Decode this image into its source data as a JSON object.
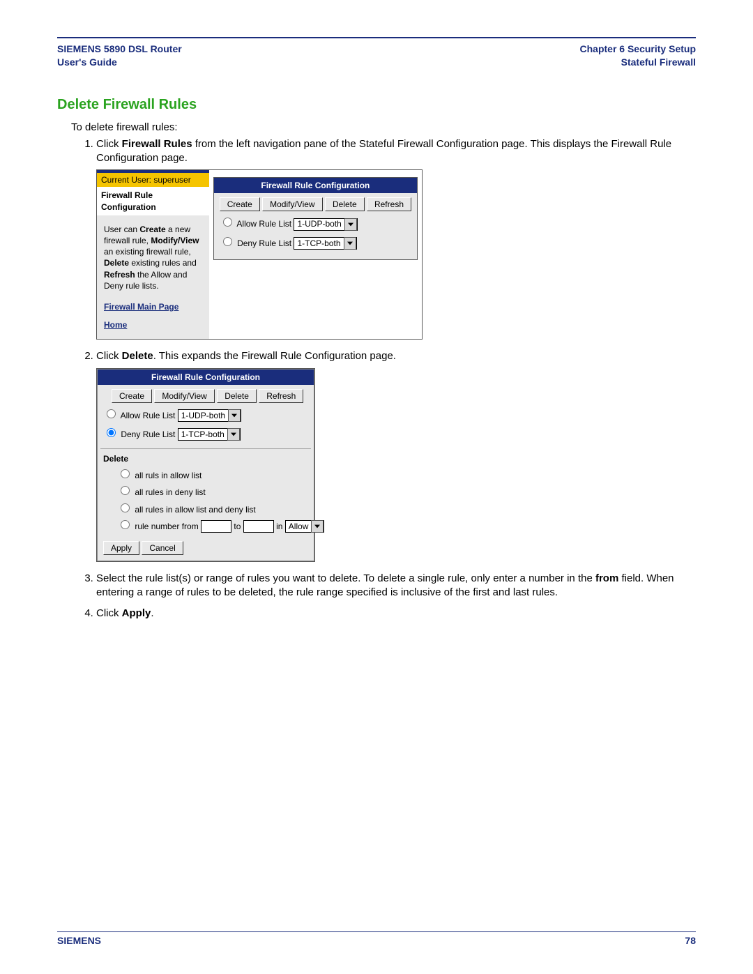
{
  "header": {
    "left_line1": "SIEMENS 5890 DSL Router",
    "left_line2": "User's Guide",
    "right_line1": "Chapter 6  Security Setup",
    "right_line2": "Stateful Firewall"
  },
  "section_title": "Delete Firewall Rules",
  "intro": "To delete firewall rules:",
  "steps": {
    "s1_pre": "Click ",
    "s1_bold": "Firewall Rules",
    "s1_post": " from the left navigation pane of the Stateful Firewall Configuration page. This displays the Firewall Rule Configuration page.",
    "s2_pre": "Click ",
    "s2_bold": "Delete",
    "s2_post": ". This expands the Firewall Rule Configuration page.",
    "s3_pre": "Select the rule list(s) or range of rules you want to delete. To delete a single rule, only enter a number in the ",
    "s3_bold": "from",
    "s3_post": " field. When entering a range of rules to be deleted, the rule range specified is inclusive of the first and last rules.",
    "s4_pre": "Click ",
    "s4_bold": "Apply",
    "s4_post": "."
  },
  "shot1": {
    "userbar": "Current User: superuser",
    "side_title": "Firewall Rule Configuration",
    "side_text_html": {
      "p1a": "User can ",
      "p1b": "Create",
      "p1c": " a new firewall rule, ",
      "p2a": "Modify/View",
      "p2b": " an existing firewall rule, ",
      "p3a": "Delete",
      "p3b": " existing rules and ",
      "p3c": "Refresh",
      "p3d": " the Allow and Deny rule lists."
    },
    "link_main": "Firewall Main Page",
    "link_home": "Home",
    "panel_title": "Firewall Rule Configuration",
    "btn_create": "Create",
    "btn_modify": "Modify/View",
    "btn_delete": "Delete",
    "btn_refresh": "Refresh",
    "allow_label": "Allow Rule List",
    "allow_value": "1-UDP-both",
    "deny_label": "Deny Rule List",
    "deny_value": "1-TCP-both"
  },
  "shot2": {
    "panel_title": "Firewall Rule Configuration",
    "btn_create": "Create",
    "btn_modify": "Modify/View",
    "btn_delete": "Delete",
    "btn_refresh": "Refresh",
    "allow_label": "Allow Rule List",
    "allow_value": "1-UDP-both",
    "deny_label": "Deny Rule List",
    "deny_value": "1-TCP-both",
    "delete_header": "Delete",
    "opt1": "all ruls in allow list",
    "opt2": "all rules in deny list",
    "opt3": "all rules in allow list and deny list",
    "opt4_pre": "rule number from",
    "opt4_to": "to",
    "opt4_in": "in",
    "opt4_select": "Allow",
    "btn_apply": "Apply",
    "btn_cancel": "Cancel"
  },
  "footer": {
    "brand": "SIEMENS",
    "page_no": "78"
  }
}
